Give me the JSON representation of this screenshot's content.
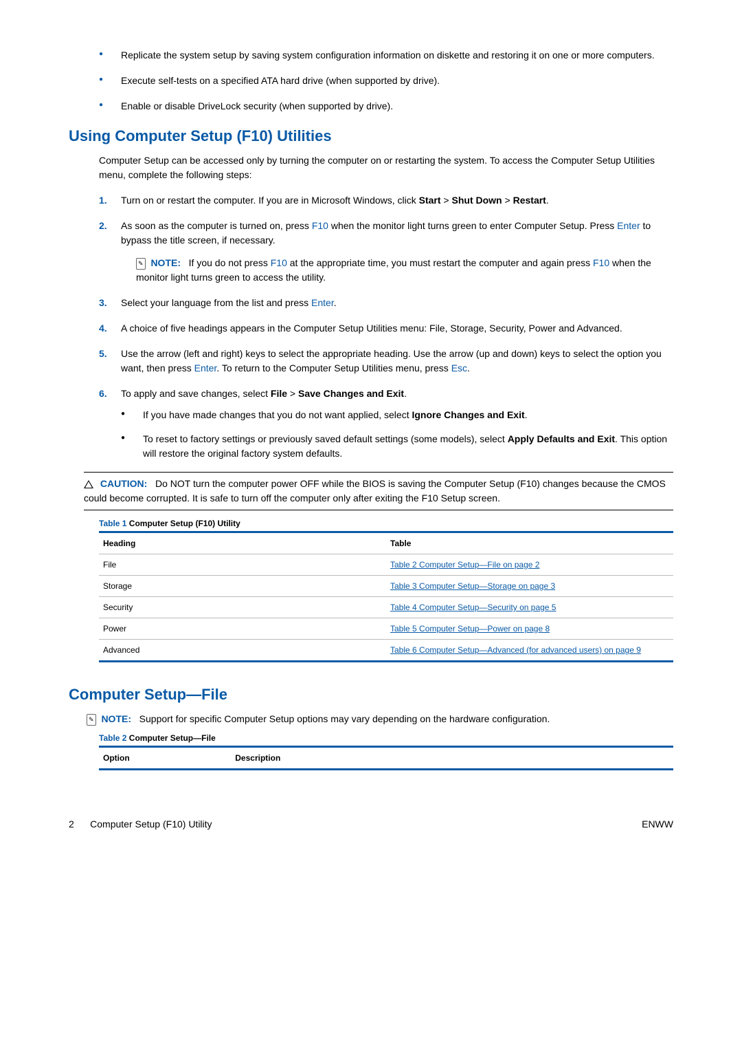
{
  "top_bullets": [
    "Replicate the system setup by saving system configuration information on diskette and restoring it on one or more computers.",
    "Execute self-tests on a specified ATA hard drive (when supported by drive).",
    "Enable or disable DriveLock security (when supported by drive)."
  ],
  "section1_title": "Using Computer Setup (F10) Utilities",
  "intro": "Computer Setup can be accessed only by turning the computer on or restarting the system. To access the Computer Setup Utilities menu, complete the following steps:",
  "step1_a": "Turn on or restart the computer. If you are in Microsoft Windows, click ",
  "step1_b": "Start",
  "step1_c": " > ",
  "step1_d": "Shut Down",
  "step1_e": " > ",
  "step1_f": "Restart",
  "step1_g": ".",
  "step2_a": "As soon as the computer is turned on, press ",
  "step2_key1": "F10",
  "step2_b": " when the monitor light turns green to enter Computer Setup. Press ",
  "step2_key2": "Enter",
  "step2_c": " to bypass the title screen, if necessary.",
  "note_label": "NOTE:",
  "note1_a": "If you do not press ",
  "note1_key1": "F10",
  "note1_b": " at the appropriate time, you must restart the computer and again press ",
  "note1_key2": "F10",
  "note1_c": " when the monitor light turns green to access the utility.",
  "step3_a": "Select your language from the list and press ",
  "step3_key": "Enter",
  "step3_b": ".",
  "step4": "A choice of five headings appears in the Computer Setup Utilities menu: File, Storage, Security, Power and Advanced.",
  "step5_a": "Use the arrow (left and right) keys to select the appropriate heading. Use the arrow (up and down) keys to select the option you want, then press ",
  "step5_key1": "Enter",
  "step5_b": ". To return to the Computer Setup Utilities menu, press ",
  "step5_key2": "Esc",
  "step5_c": ".",
  "step6_a": "To apply and save changes, select ",
  "step6_b": "File",
  "step6_c": " > ",
  "step6_d": "Save Changes and Exit",
  "step6_e": ".",
  "sub6_1_a": "If you have made changes that you do not want applied, select ",
  "sub6_1_b": "Ignore Changes and Exit",
  "sub6_1_c": ".",
  "sub6_2_a": "To reset to factory settings or previously saved default settings (some models), select ",
  "sub6_2_b": "Apply Defaults and Exit",
  "sub6_2_c": ". This option will restore the original factory system defaults.",
  "caution_label": "CAUTION:",
  "caution_text": "Do NOT turn the computer power OFF while the BIOS is saving the Computer Setup (F10) changes because the CMOS could become corrupted. It is safe to turn off the computer only after exiting the F10 Setup screen.",
  "table1_prefix": "Table 1 ",
  "table1_title": "Computer Setup (F10) Utility",
  "table1_head1": "Heading",
  "table1_head2": "Table",
  "table1_rows": [
    {
      "h": "File",
      "l": "Table 2 Computer Setup—File on page 2"
    },
    {
      "h": "Storage",
      "l": "Table 3 Computer Setup—Storage on page 3"
    },
    {
      "h": "Security",
      "l": "Table 4 Computer Setup—Security on page 5"
    },
    {
      "h": "Power",
      "l": "Table 5 Computer Setup—Power on page 8"
    },
    {
      "h": "Advanced",
      "l": "Table 6 Computer Setup—Advanced (for advanced users) on page 9"
    }
  ],
  "section2_title": "Computer Setup—File",
  "note2_text": "Support for specific Computer Setup options may vary depending on the hardware configuration.",
  "table2_prefix": "Table 2 ",
  "table2_title": "Computer Setup—File",
  "table2_head1": "Option",
  "table2_head2": "Description",
  "footer_left_num": "2",
  "footer_left_text": "Computer Setup (F10) Utility",
  "footer_right": "ENWW"
}
